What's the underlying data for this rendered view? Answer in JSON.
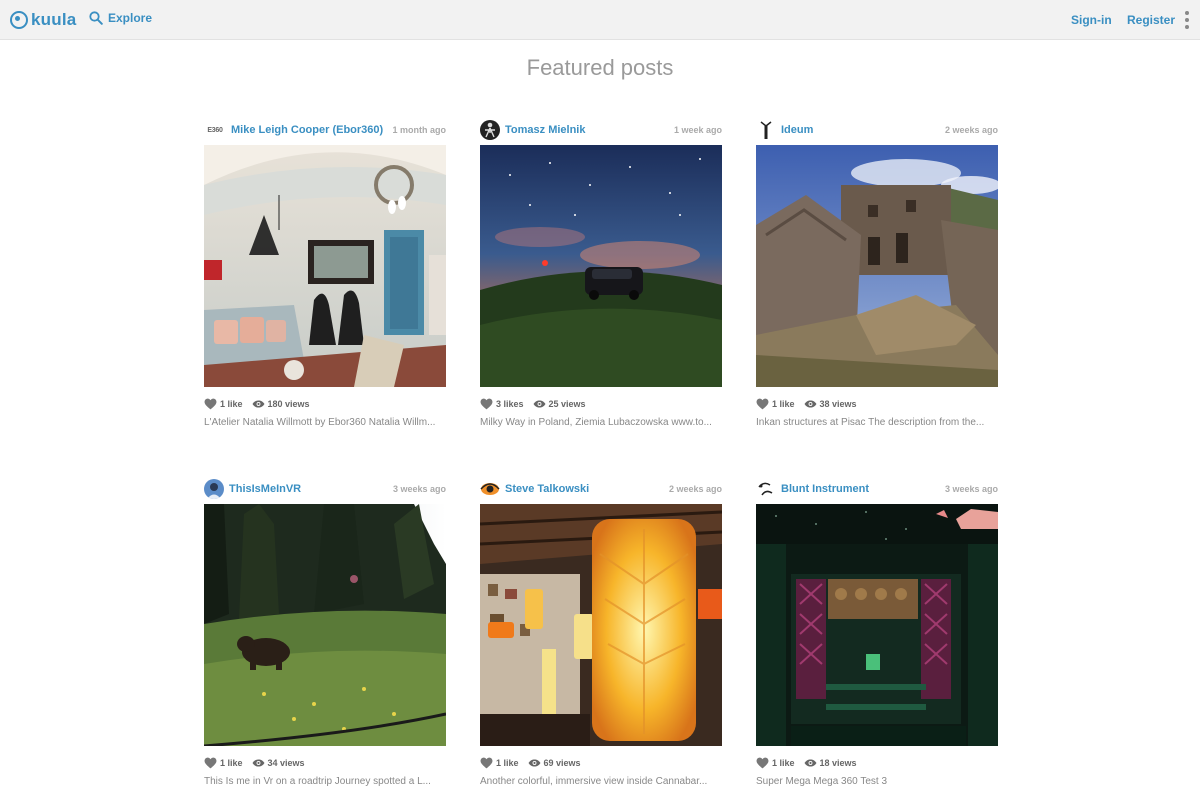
{
  "header": {
    "logo_text": "kuula",
    "explore_label": "Explore",
    "signin_label": "Sign-in",
    "register_label": "Register",
    "accent_color": "#3a8fc2"
  },
  "page": {
    "title": "Featured posts"
  },
  "posts": [
    {
      "author": "Mike Leigh Cooper (Ebor360)",
      "time": "1 month ago",
      "likes": "1 like",
      "views": "180 views",
      "description": "L'Atelier Natalia Willmott by Ebor360 Natalia Willm...",
      "avatar_text": "E360"
    },
    {
      "author": "Tomasz Mielnik",
      "time": "1 week ago",
      "likes": "3 likes",
      "views": "25 views",
      "description": "Milky Way in Poland, Ziemia Lubaczowska www.to...",
      "avatar_text": ""
    },
    {
      "author": "Ideum",
      "time": "2 weeks ago",
      "likes": "1 like",
      "views": "38 views",
      "description": "Inkan structures at Pisac The description from the...",
      "avatar_text": ""
    },
    {
      "author": "ThisIsMeInVR",
      "time": "3 weeks ago",
      "likes": "1 like",
      "views": "34 views",
      "description": "This Is me in Vr on a roadtrip Journey spotted a L...",
      "avatar_text": ""
    },
    {
      "author": "Steve Talkowski",
      "time": "2 weeks ago",
      "likes": "1 like",
      "views": "69 views",
      "description": "Another colorful, immersive view inside Cannabar...",
      "avatar_text": ""
    },
    {
      "author": "Blunt Instrument",
      "time": "3 weeks ago",
      "likes": "1 like",
      "views": "18 views",
      "description": "Super Mega Mega 360 Test 3",
      "avatar_text": ""
    }
  ]
}
